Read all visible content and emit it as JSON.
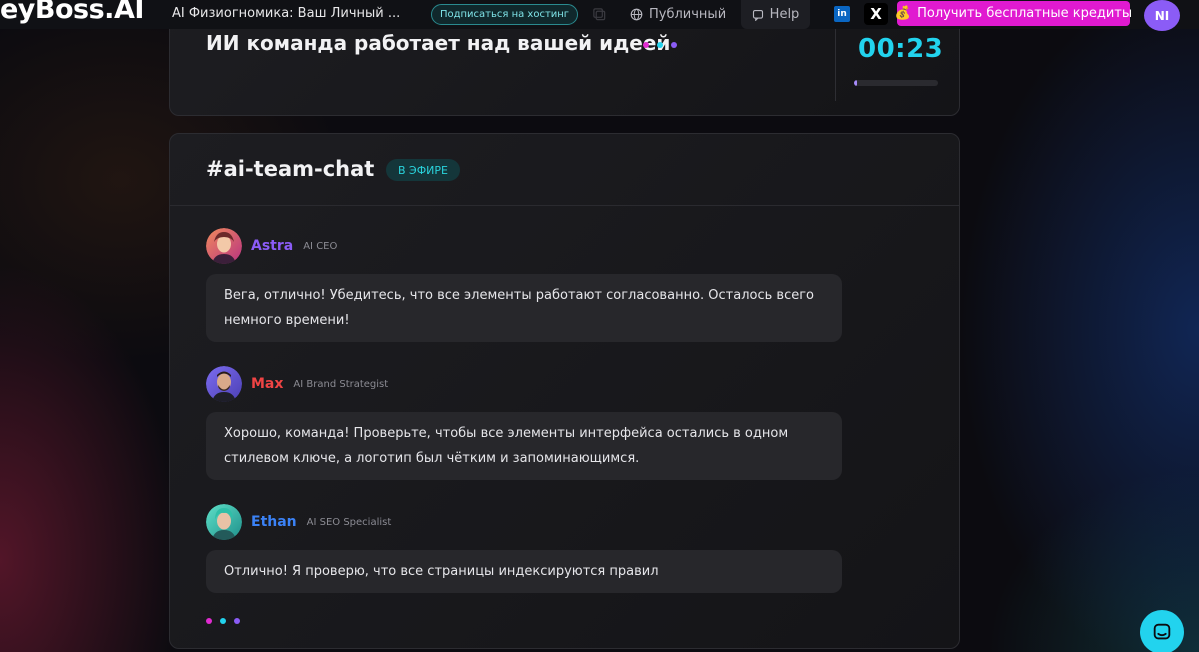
{
  "topbar": {
    "logo": "eyBoss.AI",
    "app_title": "AI Физиогномика: Ваш Личный ...",
    "subscribe_label": "Подписаться на хостинг",
    "public_label": "Публичный",
    "help_label": "Help",
    "linkedin_label": "in",
    "x_label": "X",
    "credits_label": "Получить бесплатные кредиты",
    "avatar_initials": "NI"
  },
  "status_card": {
    "heading": "ИИ команда работает над вашей идеей",
    "timer": "00:23",
    "progress": 0.04
  },
  "chat": {
    "title": "#ai-team-chat",
    "badge": "В ЭФИРЕ",
    "messages": [
      {
        "name": "Astra",
        "role": "AI CEO",
        "text": "Вега, отлично! Убедитесь, что все элементы работают согласованно. Осталось всего немного времени!"
      },
      {
        "name": "Max",
        "role": "AI Brand Strategist",
        "text": "Хорошо, команда! Проверьте, чтобы все элементы интерфейса остались в одном стилевом ключе, а логотип был чётким и запоминающимся."
      },
      {
        "name": "Ethan",
        "role": "AI SEO Specialist",
        "text": "Отлично! Я проверю, что все страницы индексируются правил"
      }
    ]
  },
  "colors": {
    "accent_cyan": "#22d3ee",
    "accent_pink": "#e01ad0",
    "accent_purple": "#8b5cf6",
    "astra_name": "#8b5cf6",
    "max_name": "#ef4444",
    "ethan_name": "#3b82f6"
  },
  "icons": {
    "copy": "copy-icon",
    "public": "globe-icon",
    "help": "chat-bubble-icon",
    "credits": "money-bag-icon",
    "support": "chat-support-icon"
  }
}
